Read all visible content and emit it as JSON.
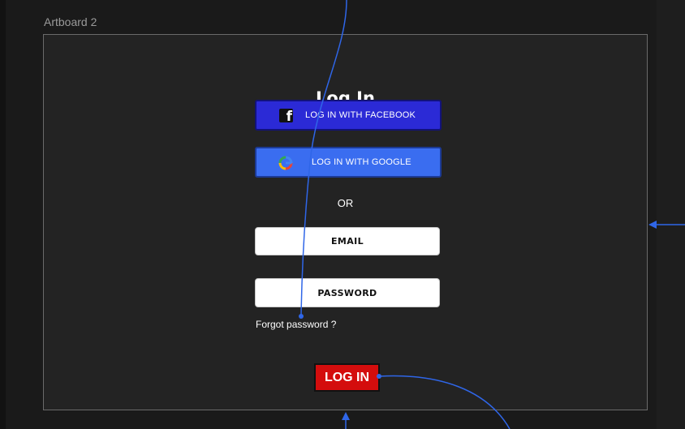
{
  "artboard": {
    "label": "Artboard 2"
  },
  "screen": {
    "title": "Log In",
    "facebook_button": "LOG IN WITH FACEBOOK",
    "google_button": "LOG IN WITH GOOGLE",
    "or_label": "OR",
    "email_label": "EMAIL",
    "password_label": "PASSWORD",
    "forgot_link": "Forgot password ?",
    "login_button": "LOG IN"
  },
  "icons": {
    "facebook": "facebook-icon",
    "google": "google-icon",
    "connector_arrow": "arrow-icon"
  },
  "colors": {
    "canvas": "#1a1a1a",
    "artboard_bg": "#232323",
    "facebook_blue": "#2b2ad6",
    "google_blue": "#3a6df0",
    "login_red": "#d40d0d",
    "flow_line": "#2f66e8"
  }
}
